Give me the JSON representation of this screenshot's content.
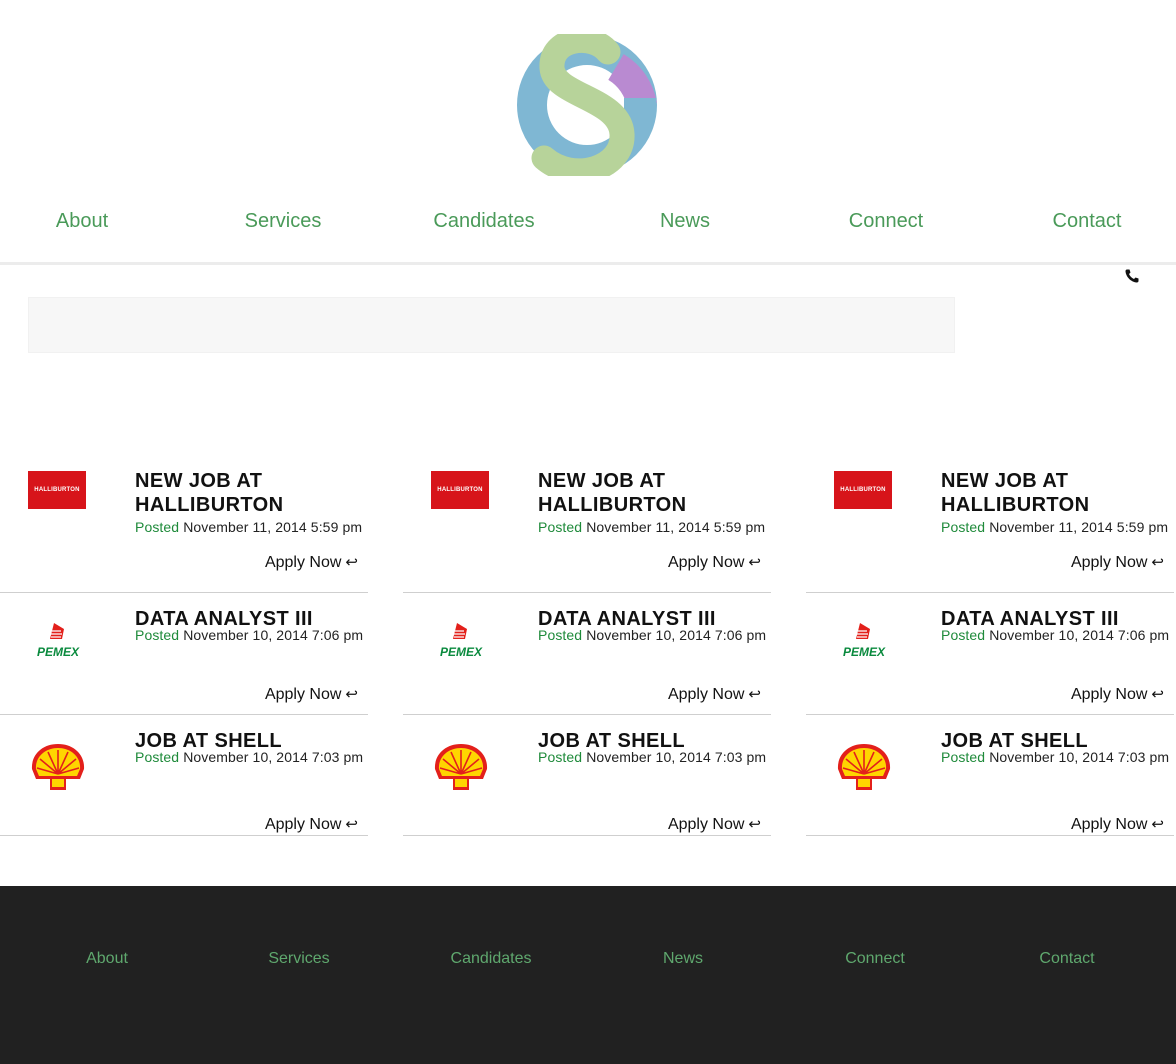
{
  "nav": {
    "items": [
      "About",
      "Services",
      "Candidates",
      "News",
      "Connect",
      "Contact"
    ]
  },
  "header_icons": {
    "phone": "phone-icon"
  },
  "jobs": [
    {
      "title": "New Job at Halliburton",
      "posted_label": "Posted",
      "date": "November 11, 2014 5:59 pm",
      "apply_label": "Apply Now",
      "logo": "halliburton-logo",
      "logo_text": "HALLIBURTON",
      "logo_color": "#d7141a"
    },
    {
      "title": "Data Analyst III",
      "posted_label": "Posted",
      "date": "November 10, 2014 7:06 pm",
      "apply_label": "Apply Now",
      "logo": "pemex-logo",
      "logo_text": "PEMEX",
      "logo_color": "#0a8a3e"
    },
    {
      "title": "Job at Shell",
      "posted_label": "Posted",
      "date": "November 10, 2014 7:03 pm",
      "apply_label": "Apply Now",
      "logo": "shell-logo",
      "logo_color": "#e3201b"
    }
  ],
  "apply_icon": "return-arrow-icon",
  "footer": {
    "items": [
      "About",
      "Services",
      "Candidates",
      "News",
      "Connect",
      "Contact"
    ]
  },
  "colors": {
    "nav_link": "#4a9a59",
    "footer_bg": "#212121",
    "footer_link": "#5fa86e",
    "posted": "#1e8a3a",
    "logo_blue": "#7fb7d3",
    "logo_green": "#b7d39a",
    "logo_purple": "#b98ad1"
  }
}
